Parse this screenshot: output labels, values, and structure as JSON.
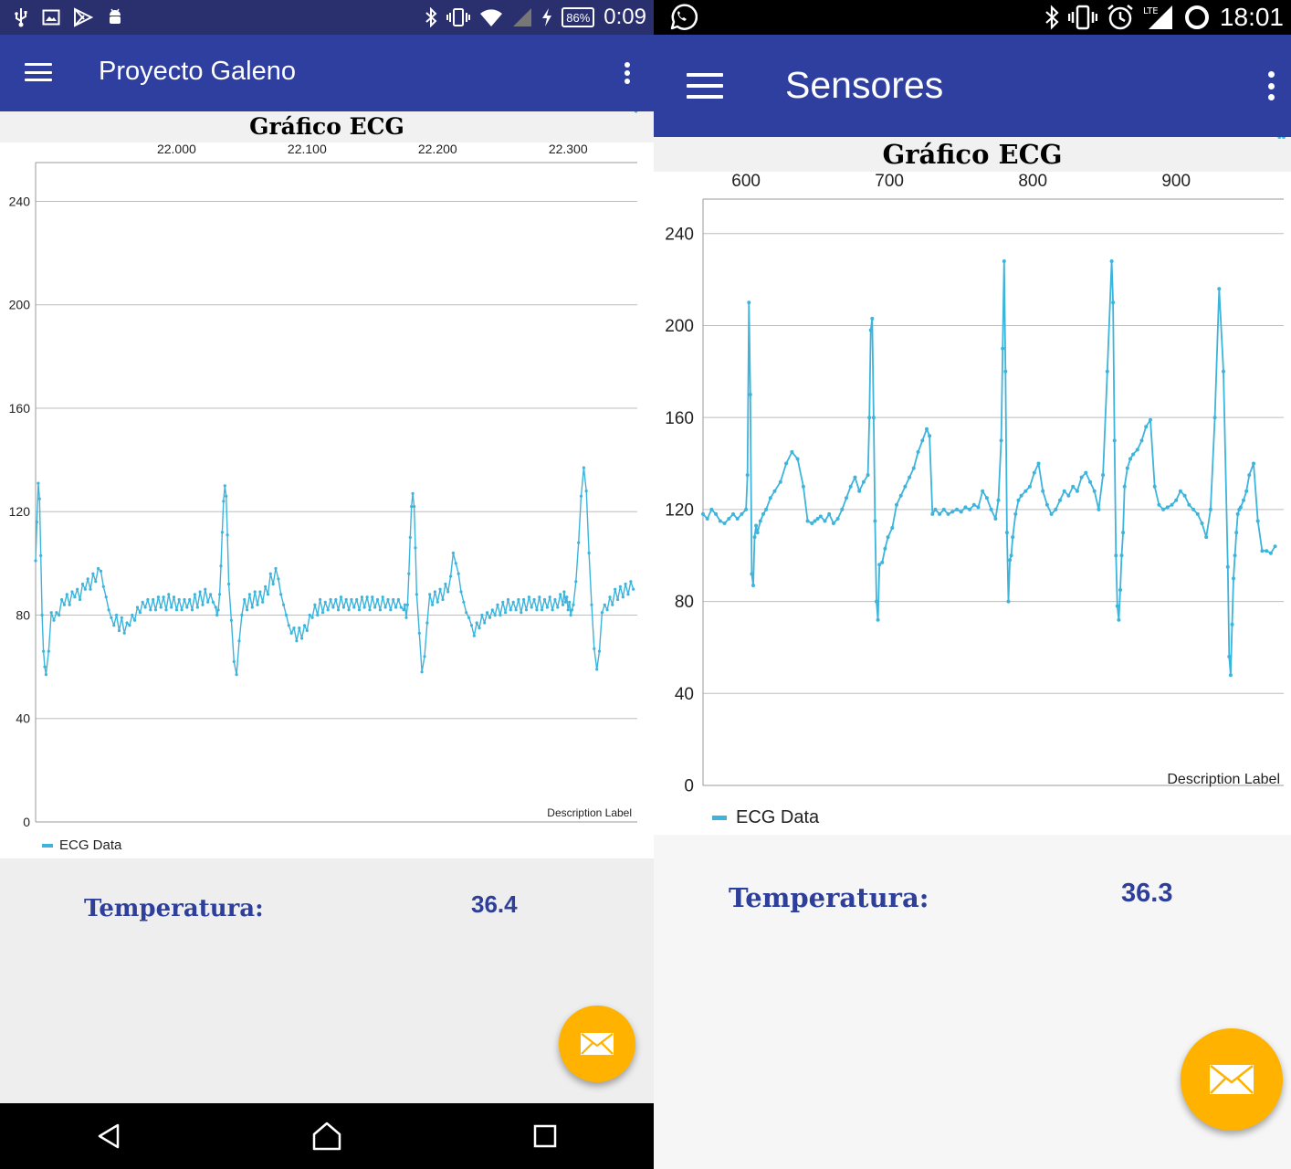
{
  "screens": [
    {
      "status_bar": {
        "left_icons": [
          "usb-icon",
          "image-icon",
          "play-store-icon",
          "android-icon"
        ],
        "right_icons": [
          "bluetooth-icon",
          "vibrate-icon",
          "wifi-icon",
          "signal-icon",
          "charging-icon"
        ],
        "battery": "86%",
        "time": "0:09",
        "background": "#2a2f6e"
      },
      "app_bar": {
        "title": "Proyecto Galeno",
        "color": "#2e3fa0"
      },
      "chart_data": {
        "type": "line",
        "title": "Gráfico ECG",
        "description": "Description Label",
        "x_ticks": [
          22000,
          22100,
          22200,
          22300
        ],
        "x_tick_labels": [
          "22.000",
          "22.100",
          "22.200",
          "22.300"
        ],
        "xlim": [
          21892,
          22353
        ],
        "ylim": [
          0,
          255
        ],
        "y_ticks": [
          0,
          40,
          80,
          120,
          160,
          200,
          240
        ],
        "y_tick_labels": [
          "0",
          "40",
          "80",
          "120",
          "160",
          "200",
          "240"
        ],
        "grid": true,
        "series": [
          {
            "name": "ECG Data",
            "color": "#3cb4dc",
            "x": [
              21892,
              21893,
              21894,
              21895,
              21896,
              21897,
              21898,
              21899,
              21900,
              21902,
              21904,
              21906,
              21908,
              21910,
              21912,
              21914,
              21916,
              21918,
              21920,
              21922,
              21924,
              21926,
              21928,
              21930,
              21932,
              21934,
              21936,
              21938,
              21940,
              21942,
              21944,
              21946,
              21948,
              21950,
              21952,
              21954,
              21956,
              21958,
              21960,
              21962,
              21964,
              21966,
              21968,
              21970,
              21972,
              21974,
              21976,
              21978,
              21980,
              21982,
              21984,
              21986,
              21988,
              21990,
              21992,
              21994,
              21996,
              21998,
              22000,
              22002,
              22004,
              22006,
              22008,
              22010,
              22012,
              22014,
              22016,
              22018,
              22020,
              22022,
              22024,
              22026,
              22028,
              22030,
              22031,
              22032,
              22033,
              22034,
              22035,
              22036,
              22037,
              22038,
              22039,
              22040,
              22042,
              22044,
              22046,
              22048,
              22050,
              22052,
              22054,
              22056,
              22058,
              22060,
              22062,
              22064,
              22066,
              22068,
              22070,
              22072,
              22074,
              22076,
              22078,
              22080,
              22082,
              22084,
              22086,
              22088,
              22090,
              22092,
              22094,
              22096,
              22098,
              22100,
              22102,
              22104,
              22106,
              22108,
              22110,
              22112,
              22114,
              22116,
              22118,
              22120,
              22122,
              22124,
              22126,
              22128,
              22130,
              22132,
              22134,
              22136,
              22138,
              22140,
              22142,
              22144,
              22146,
              22148,
              22150,
              22152,
              22154,
              22156,
              22158,
              22160,
              22162,
              22164,
              22166,
              22168,
              22170,
              22172,
              22174,
              22175,
              22176,
              22177,
              22178,
              22179,
              22180,
              22181,
              22182,
              22183,
              22184,
              22186,
              22188,
              22190,
              22192,
              22194,
              22196,
              22198,
              22200,
              22202,
              22204,
              22206,
              22208,
              22210,
              22212,
              22214,
              22216,
              22218,
              22220,
              22222,
              22224,
              22226,
              22228,
              22230,
              22232,
              22234,
              22236,
              22238,
              22240,
              22242,
              22244,
              22246,
              22248,
              22250,
              22252,
              22254,
              22256,
              22258,
              22260,
              22262,
              22264,
              22266,
              22268,
              22270,
              22272,
              22274,
              22276,
              22278,
              22280,
              22282,
              22284,
              22286,
              22288,
              22290,
              22292,
              22294,
              22296,
              22297,
              22298,
              22299,
              22300,
              22301,
              22302,
              22303,
              22304,
              22306,
              22308,
              22310,
              22312,
              22314,
              22316,
              22318,
              22320,
              22322,
              22324,
              22326,
              22328,
              22330,
              22332,
              22334,
              22336,
              22338,
              22340,
              22342,
              22344,
              22346,
              22348,
              22350,
              22352
            ],
            "y": [
              101,
              116,
              131,
              125,
              103,
              80,
              66,
              60,
              57,
              66,
              81,
              78,
              81,
              80,
              86,
              84,
              88,
              84,
              89,
              87,
              90,
              86,
              92,
              90,
              94,
              90,
              96,
              93,
              98,
              97,
              91,
              87,
              82,
              79,
              76,
              80,
              74,
              79,
              73,
              77,
              76,
              80,
              78,
              83,
              81,
              85,
              83,
              86,
              82,
              86,
              82,
              87,
              83,
              87,
              82,
              88,
              83,
              87,
              82,
              86,
              82,
              86,
              83,
              86,
              82,
              88,
              83,
              89,
              84,
              90,
              85,
              88,
              85,
              83,
              80,
              82,
              88,
              99,
              112,
              124,
              130,
              126,
              111,
              92,
              78,
              62,
              57,
              70,
              80,
              86,
              82,
              88,
              83,
              89,
              84,
              89,
              85,
              91,
              88,
              96,
              92,
              98,
              94,
              88,
              84,
              80,
              76,
              73,
              75,
              70,
              75,
              71,
              76,
              74,
              80,
              79,
              84,
              80,
              86,
              81,
              85,
              82,
              86,
              83,
              86,
              82,
              87,
              83,
              86,
              82,
              86,
              83,
              86,
              82,
              87,
              83,
              87,
              82,
              87,
              83,
              86,
              82,
              87,
              83,
              86,
              82,
              86,
              83,
              86,
              83,
              82,
              84,
              79,
              84,
              96,
              110,
              122,
              127,
              122,
              106,
              88,
              73,
              58,
              64,
              77,
              88,
              84,
              89,
              85,
              90,
              86,
              92,
              89,
              95,
              104,
              100,
              96,
              89,
              85,
              81,
              79,
              76,
              72,
              77,
              75,
              80,
              77,
              81,
              79,
              82,
              80,
              84,
              80,
              85,
              81,
              86,
              82,
              85,
              82,
              86,
              81,
              86,
              82,
              87,
              83,
              86,
              82,
              87,
              82,
              86,
              83,
              87,
              82,
              86,
              83,
              88,
              84,
              89,
              85,
              87,
              82,
              85,
              80,
              82,
              84,
              93,
              108,
              126,
              137,
              128,
              104,
              84,
              67,
              59,
              66,
              81,
              84,
              82,
              87,
              84,
              90,
              86,
              91,
              87,
              92,
              88,
              93,
              90
            ]
          }
        ]
      },
      "temperature": {
        "label": "Temperatura:",
        "value": "36.4"
      },
      "fab": {
        "icon": "mail-icon",
        "color": "#ffb300"
      },
      "nav_bar": {
        "icons": [
          "back-icon",
          "home-icon",
          "recents-icon"
        ]
      }
    },
    {
      "status_bar": {
        "left_icons": [
          "whatsapp-icon"
        ],
        "right_icons": [
          "bluetooth-icon",
          "vibrate-icon",
          "alarm-icon",
          "lte-signal-icon",
          "battery-circle-icon"
        ],
        "time": "18:01",
        "background": "#000000"
      },
      "app_bar": {
        "title": "Sensores",
        "color": "#2e3fa0"
      },
      "chart_data": {
        "type": "line",
        "title": "Gráfico ECG",
        "description": "Description Label",
        "x_ticks": [
          600,
          700,
          800,
          900
        ],
        "x_tick_labels": [
          "600",
          "700",
          "800",
          "900"
        ],
        "xlim": [
          570,
          975
        ],
        "ylim": [
          0,
          255
        ],
        "y_ticks": [
          0,
          40,
          80,
          120,
          160,
          200,
          240
        ],
        "y_tick_labels": [
          "0",
          "40",
          "80",
          "120",
          "160",
          "200",
          "240"
        ],
        "grid": true,
        "series": [
          {
            "name": "ECG Data",
            "color": "#3cb4dc",
            "x": [
              570,
              573,
              576,
              579,
              582,
              585,
              588,
              591,
              594,
              597,
              600,
              601,
              602,
              603,
              604,
              605,
              606,
              607,
              608,
              610,
              612,
              614,
              617,
              620,
              624,
              628,
              632,
              636,
              640,
              643,
              646,
              648,
              650,
              652,
              655,
              658,
              661,
              664,
              667,
              670,
              673,
              676,
              679,
              682,
              685,
              686,
              687,
              688,
              689,
              690,
              691,
              692,
              693,
              695,
              697,
              699,
              702,
              705,
              708,
              711,
              714,
              717,
              720,
              723,
              726,
              728,
              730,
              732,
              735,
              738,
              741,
              744,
              747,
              750,
              753,
              756,
              759,
              762,
              765,
              768,
              771,
              774,
              776,
              778,
              779,
              780,
              781,
              782,
              783,
              784,
              785,
              786,
              788,
              790,
              792,
              795,
              798,
              801,
              804,
              807,
              810,
              813,
              816,
              819,
              822,
              825,
              828,
              831,
              834,
              837,
              840,
              843,
              846,
              849,
              852,
              855,
              856,
              857,
              858,
              859,
              860,
              861,
              862,
              863,
              864,
              866,
              868,
              870,
              873,
              876,
              879,
              882,
              885,
              888,
              891,
              894,
              897,
              900,
              903,
              906,
              909,
              912,
              915,
              918,
              921,
              924,
              927,
              930,
              933,
              936,
              937,
              938,
              939,
              940,
              941,
              942,
              943,
              944,
              945,
              947,
              949,
              951,
              954,
              957,
              960,
              963,
              966,
              969,
              972,
              975
            ],
            "y": [
              118,
              116,
              120,
              118,
              115,
              114,
              116,
              118,
              116,
              118,
              120,
              135,
              210,
              170,
              92,
              87,
              108,
              113,
              110,
              115,
              118,
              120,
              125,
              128,
              132,
              140,
              145,
              142,
              130,
              115,
              114,
              115,
              116,
              117,
              115,
              118,
              114,
              116,
              120,
              125,
              130,
              134,
              128,
              132,
              135,
              160,
              198,
              203,
              160,
              115,
              80,
              72,
              96,
              97,
              103,
              108,
              112,
              122,
              126,
              130,
              134,
              138,
              145,
              150,
              155,
              152,
              118,
              120,
              118,
              120,
              118,
              119,
              120,
              119,
              121,
              120,
              122,
              121,
              128,
              125,
              120,
              116,
              124,
              150,
              190,
              228,
              180,
              110,
              80,
              98,
              100,
              108,
              118,
              124,
              126,
              128,
              130,
              136,
              140,
              128,
              122,
              118,
              120,
              124,
              128,
              126,
              130,
              128,
              134,
              136,
              132,
              128,
              120,
              135,
              180,
              228,
              210,
              150,
              100,
              78,
              72,
              85,
              100,
              110,
              130,
              138,
              142,
              144,
              146,
              150,
              156,
              159,
              130,
              122,
              120,
              121,
              122,
              124,
              128,
              126,
              122,
              120,
              118,
              114,
              108,
              120,
              160,
              216,
              180,
              95,
              56,
              48,
              70,
              90,
              100,
              110,
              118,
              120,
              121,
              124,
              128,
              135,
              140,
              115,
              102,
              102,
              101,
              104
            ]
          }
        ]
      },
      "temperature": {
        "label": "Temperatura:",
        "value": "36.3"
      },
      "fab": {
        "icon": "mail-icon",
        "color": "#ffb300"
      }
    }
  ]
}
